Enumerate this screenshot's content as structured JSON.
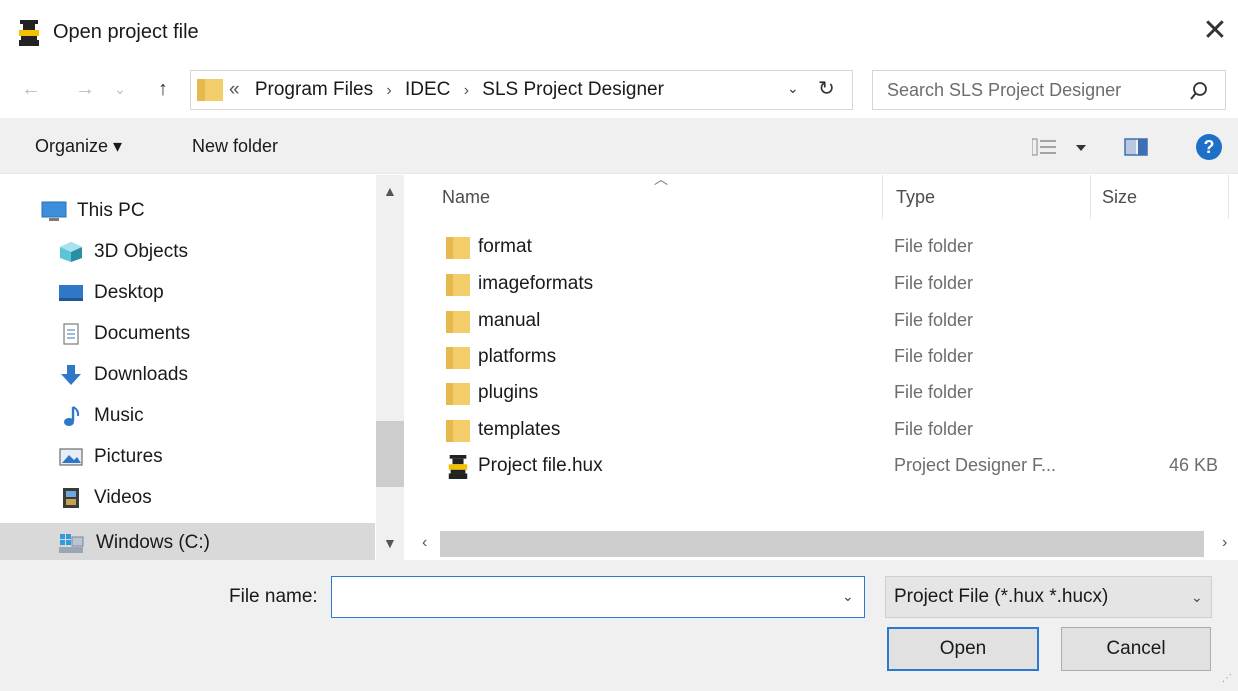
{
  "window": {
    "title": "Open project file",
    "app_icon": "project-designer-icon",
    "close_glyph": "✕"
  },
  "nav": {
    "back_glyph": "←",
    "forward_glyph": "→",
    "recent_glyph": "⌄",
    "up_glyph": "↑",
    "crumb_prefix": "«",
    "breadcrumbs": [
      "Program Files",
      "IDEC",
      "SLS Project Designer"
    ],
    "crumb_separator": "›",
    "dropdown_glyph": "⌄",
    "refresh_glyph": "↻"
  },
  "search": {
    "placeholder": "Search SLS Project Designer"
  },
  "toolbar": {
    "organize_label": "Organize ▾",
    "new_folder_label": "New folder",
    "help_label": "?"
  },
  "sidebar": {
    "items": [
      {
        "label": "This PC",
        "icon": "computer-icon"
      },
      {
        "label": "3D Objects",
        "icon": "3d-objects-icon"
      },
      {
        "label": "Desktop",
        "icon": "desktop-icon"
      },
      {
        "label": "Documents",
        "icon": "documents-icon"
      },
      {
        "label": "Downloads",
        "icon": "downloads-icon"
      },
      {
        "label": "Music",
        "icon": "music-icon"
      },
      {
        "label": "Pictures",
        "icon": "pictures-icon"
      },
      {
        "label": "Videos",
        "icon": "videos-icon"
      },
      {
        "label": "Windows (C:)",
        "icon": "drive-icon",
        "selected": true
      }
    ]
  },
  "columns": {
    "name": "Name",
    "type": "Type",
    "size": "Size"
  },
  "files": [
    {
      "name": "format",
      "type": "File folder",
      "size": ""
    },
    {
      "name": "imageformats",
      "type": "File folder",
      "size": ""
    },
    {
      "name": "manual",
      "type": "File folder",
      "size": ""
    },
    {
      "name": "platforms",
      "type": "File folder",
      "size": ""
    },
    {
      "name": "plugins",
      "type": "File folder",
      "size": ""
    },
    {
      "name": "templates",
      "type": "File folder",
      "size": ""
    },
    {
      "name": "Project file.hux",
      "type": "Project Designer F...",
      "size": "46 KB"
    }
  ],
  "footer": {
    "file_name_label": "File name:",
    "file_name_value": "",
    "filter_value": "Project File (*.hux *.hucx)",
    "open_label": "Open",
    "cancel_label": "Cancel"
  },
  "colors": {
    "folder": "#f3cd6a",
    "accent": "#2f78d1",
    "help": "#1e6fc8",
    "selected_bg": "#d9d9d9"
  }
}
